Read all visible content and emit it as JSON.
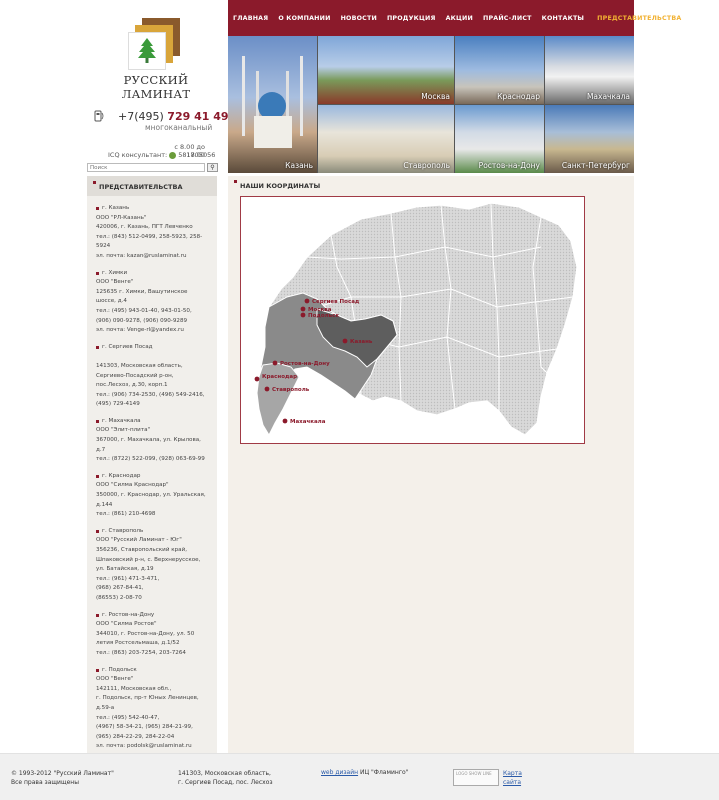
{
  "brand": {
    "name": "РУССКИЙ ЛАМИНАТ"
  },
  "contact": {
    "phone_code": "+7(495)",
    "phone_number": "729 41 49",
    "phone_note": "многоканальный",
    "hours": "с 8.00 до 17.00",
    "icq_label": "ICQ консультант:",
    "icq_number": "581805056"
  },
  "search": {
    "placeholder": "Поиск"
  },
  "nav": {
    "items": [
      "ГЛАВНАЯ",
      "О КОМПАНИИ",
      "НОВОСТИ",
      "ПРОДУКЦИЯ",
      "АКЦИИ",
      "ПРАЙС-ЛИСТ",
      "КОНТАКТЫ",
      "ПРЕДСТАВИТЕЛЬСТВА"
    ],
    "active_index": 7
  },
  "photos": [
    "Казань",
    "Москва",
    "Краснодар",
    "Махачкала",
    "Ставрополь",
    "Ростов-на-Дону",
    "Санкт-Петербург"
  ],
  "sidebar": {
    "title": "ПРЕДСТАВИТЕЛЬСТВА",
    "entries": [
      [
        "г. Казань",
        "ООО \"РЛ-Казань\"",
        "420006, г. Казань, ПГТ Левченко",
        "тел.: (843) 512-0499, 258-5923, 258-",
        "5924",
        "эл. почта: kazan@ruslaminat.ru"
      ],
      [
        "г. Химки",
        "ООО \"Венге\"",
        "125635 г. Химки, Вашутинское",
        "шоссе, д.4",
        "тел.: (495) 943-01-40, 943-01-50,",
        "(906) 090-9278, (906) 090-9289",
        "эл. почта: Venge-rl@yandex.ru"
      ],
      [
        "г. Сергиев Посад",
        "",
        "141303, Московская область,",
        "Сергиево-Посадский р-он,",
        "пос.Лесхоз, д.30, корп.1",
        "тел.: (906) 734-2530, (496) 549-2416,",
        "(495) 729-4149"
      ],
      [
        "г. Махачкала",
        "ООО \"Элит-плита\"",
        "367000, г. Махачкала, ул. Крылова,",
        "д.7",
        "тел.: (8722) 522-099, (928) 063-69-99"
      ],
      [
        "г. Краснодар",
        "ООО \"Силма Краснодар\"",
        "350000, г. Краснодар, ул. Уральская,",
        "д.144",
        "тел.: (861) 210-4698"
      ],
      [
        "г. Ставрополь",
        "ООО \"Русский Ламинат - Юг\"",
        "356236, Ставропольский край,",
        "Шпаковский р-н, с. Верхнерусское,",
        "ул. Батайская, д.19",
        "тел.: (961) 471-3-471,",
        "(968) 267-84-41,",
        "(86553) 2-08-70"
      ],
      [
        "г. Ростов-на-Дону",
        "ООО \"Силма Ростов\"",
        "344010, г. Ростов-на-Дону, ул. 50",
        "летия Ростсельмаша, д.1/52",
        "тел.: (863) 203-7254, 203-7264"
      ],
      [
        "г. Подольск",
        "ООО \"Венге\"",
        "142111, Московская обл.,",
        "г. Подольск, пр-т Юных Ленинцев,",
        "д.59-а",
        "тел.: (495) 542-40-47,",
        "(4967) 58-34-21, (965) 284-21-99,",
        "(965) 284-22-29, 284-22-04",
        "эл. почта: podolsk@ruslaminat.ru"
      ]
    ]
  },
  "main": {
    "title": "НАШИ КООРДИНАТЫ"
  },
  "map": {
    "cities": [
      "Сергиев Посад",
      "Москва",
      "Подольск",
      "Казань",
      "Ростов-на-Дону",
      "Краснодар",
      "Ставрополь",
      "Махачкала"
    ],
    "marker_color": "#8b1a2b"
  },
  "footer": {
    "copyright_1": "© 1993-2012 \"Русский Ламинат\"",
    "copyright_2": "Все права защищены",
    "address_1": "141303, Московская область,",
    "address_2": "г. Сергиев Посад, пос. Лесхоз",
    "design_link": "web дизайн",
    "design_company": "ИЦ \"Фламинго\"",
    "logo_text": "LOGO SHOW LINE",
    "sitemap_1": "Карта",
    "sitemap_2": "сайта"
  },
  "colors": {
    "accent": "#8b1a2b",
    "nav_active": "#f2b233",
    "sidebar_bg": "#f1efeb",
    "main_bg": "#f4f0ea"
  }
}
